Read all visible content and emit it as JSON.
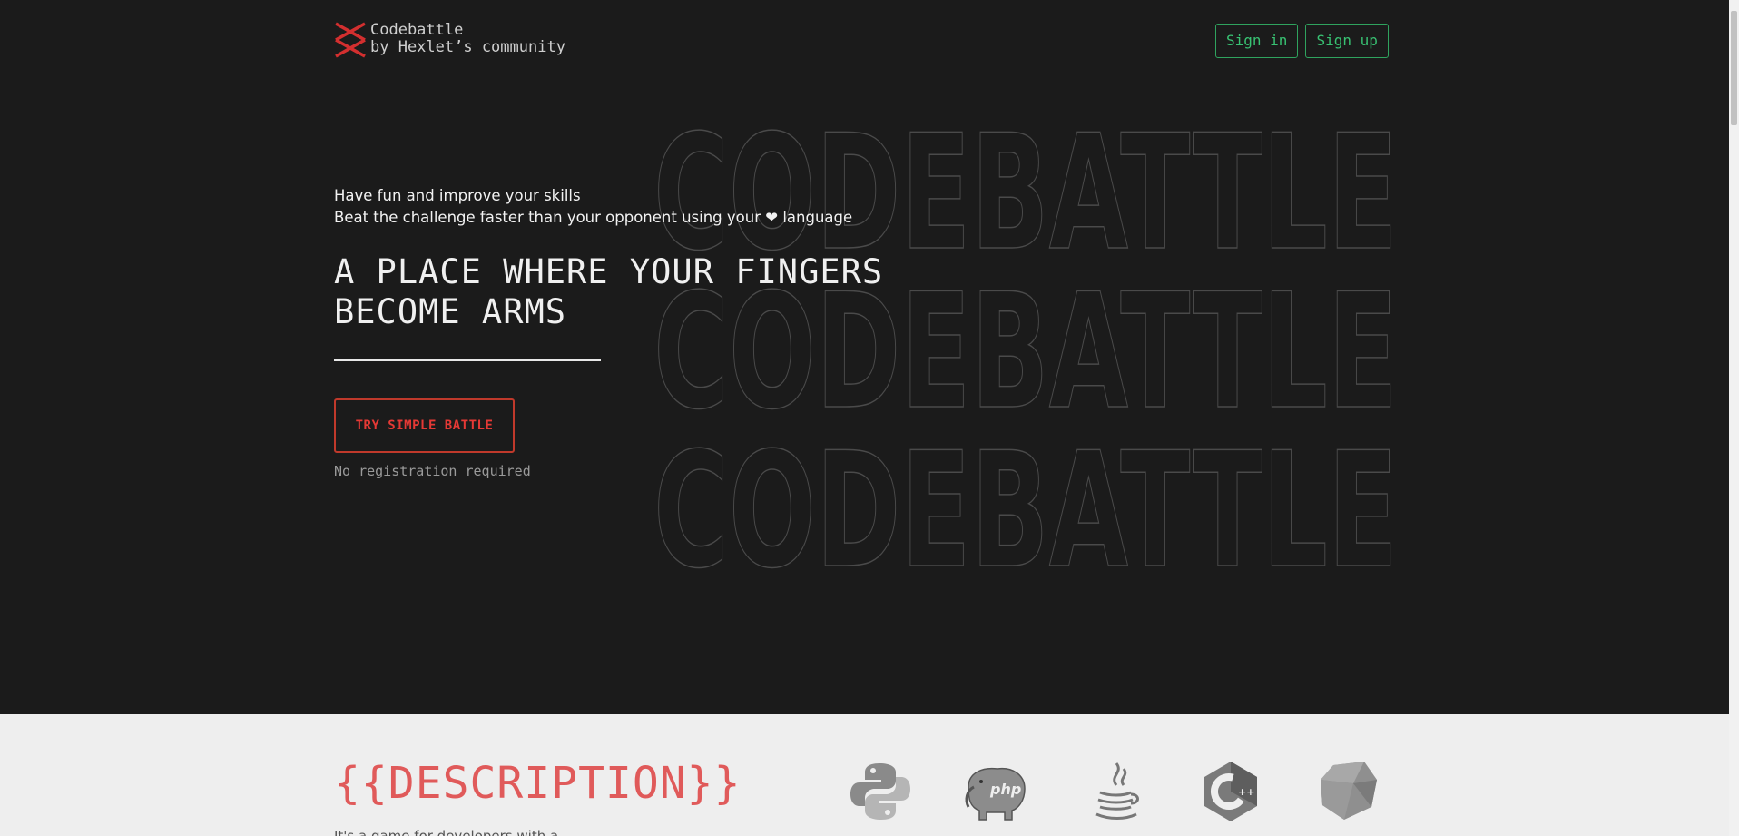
{
  "brand": {
    "name": "Codebattle",
    "subtitle": "by Hexlet’s community"
  },
  "auth": {
    "sign_in": "Sign in",
    "sign_up": "Sign up"
  },
  "hero": {
    "background_word": "CODEBATTLE",
    "tagline_1": "Have fun and improve your skills",
    "tagline_2_before": "Beat the challenge faster than your opponent using your",
    "tagline_2_heart": "❤",
    "tagline_2_after": "language",
    "headline_line1": "A PLACE WHERE YOUR FINGERS",
    "headline_line2": "BECOME ARMS",
    "cta_label": "TRY SIMPLE BATTLE",
    "cta_note": "No registration required"
  },
  "description": {
    "title": "{{DESCRIPTION}}",
    "text_partial": "It's a game for developers with a"
  },
  "languages": [
    {
      "name": "python-icon"
    },
    {
      "name": "php-icon"
    },
    {
      "name": "java-icon"
    },
    {
      "name": "cpp-icon"
    },
    {
      "name": "ruby-icon"
    }
  ],
  "colors": {
    "background": "#1b1b1b",
    "accent_red": "#e53935",
    "accent_green": "#38c172",
    "section_bg": "#eeeeee"
  }
}
